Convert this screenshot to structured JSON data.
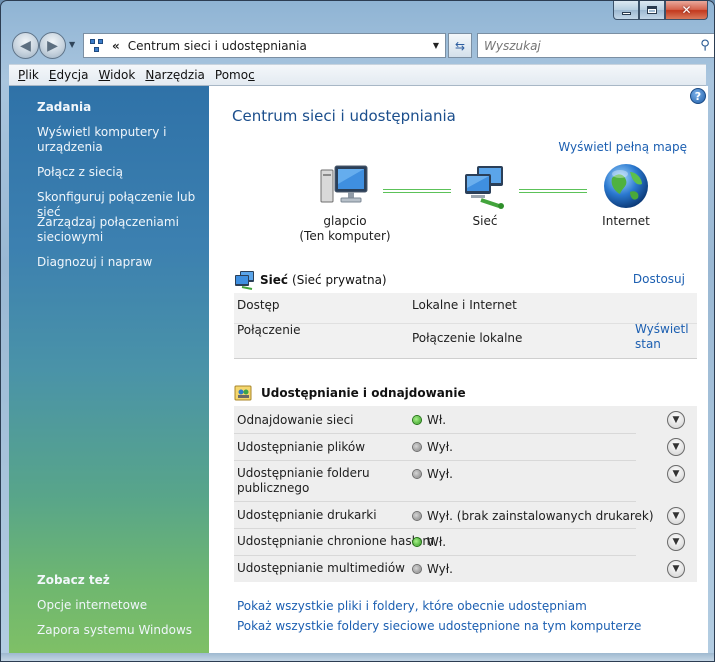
{
  "window": {
    "title": "Centrum sieci i udostępniania"
  },
  "navigation": {
    "address_chevron": "«",
    "address_text": "Centrum sieci i udostępniania",
    "search_placeholder": "Wyszukaj"
  },
  "menubar": {
    "items": [
      {
        "label": "Plik",
        "key": "P"
      },
      {
        "label": "Edycja",
        "key": "E"
      },
      {
        "label": "Widok",
        "key": "W"
      },
      {
        "label": "Narzędzia",
        "key": "N"
      },
      {
        "label": "Pomoc",
        "key": "c"
      }
    ]
  },
  "sidebar": {
    "tasks_heading": "Zadania",
    "tasks": [
      {
        "label": "Wyświetl komputery i urządzenia"
      },
      {
        "label": "Połącz z siecią"
      },
      {
        "label": "Skonfiguruj połączenie lub sieć"
      },
      {
        "label": "Zarządzaj połączeniami sieciowymi"
      },
      {
        "label": "Diagnozuj i napraw"
      }
    ],
    "see_also_heading": "Zobacz też",
    "see_also": [
      {
        "label": "Opcje internetowe"
      },
      {
        "label": "Zapora systemu Windows"
      }
    ]
  },
  "main": {
    "title": "Centrum sieci i udostępniania",
    "full_map_link": "Wyświetl pełną mapę",
    "map": {
      "computer_name": "glapcio",
      "computer_sub": "(Ten komputer)",
      "network_label": "Sieć",
      "internet_label": "Internet"
    },
    "network": {
      "name": "Sieć",
      "type": "(Sieć prywatna)",
      "customize_link": "Dostosuj",
      "rows": [
        {
          "label": "Dostęp",
          "value": "Lokalne i Internet",
          "link": ""
        },
        {
          "label": "Połączenie",
          "value": "Połączenie lokalne",
          "link": "Wyświetl stan"
        }
      ]
    },
    "sharing": {
      "heading": "Udostępnianie i odnajdowanie",
      "rows": [
        {
          "label": "Odnajdowanie sieci",
          "state": "Wł.",
          "on": true
        },
        {
          "label": "Udostępnianie plików",
          "state": "Wył.",
          "on": false
        },
        {
          "label": "Udostępnianie folderu publicznego",
          "state": "Wył.",
          "on": false
        },
        {
          "label": "Udostępnianie drukarki",
          "state": "Wył. (brak zainstalowanych drukarek)",
          "on": false
        },
        {
          "label": "Udostępnianie chronione hasłem",
          "state": "Wł.",
          "on": true
        },
        {
          "label": "Udostępnianie multimediów",
          "state": "Wył.",
          "on": false
        }
      ]
    },
    "bottom_links": [
      {
        "label": "Pokaż wszystkie pliki i foldery, które obecnie udostępniam"
      },
      {
        "label": "Pokaż wszystkie foldery sieciowe udostępnione na tym komputerze"
      }
    ]
  }
}
